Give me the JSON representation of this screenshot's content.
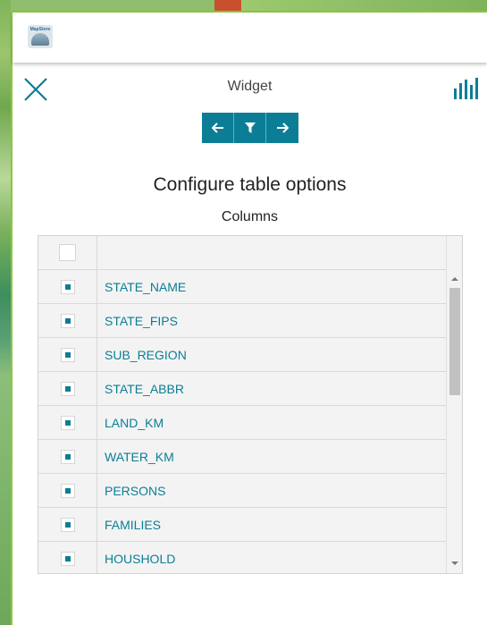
{
  "app": {
    "logo_text": "MapStore"
  },
  "header": {
    "widget_title": "Widget"
  },
  "toolbar": {
    "buttons": [
      {
        "name": "back",
        "icon": "arrow-left-icon"
      },
      {
        "name": "filter",
        "icon": "filter-icon"
      },
      {
        "name": "next",
        "icon": "arrow-right-icon"
      }
    ]
  },
  "main": {
    "page_title": "Configure table options",
    "section_title": "Columns"
  },
  "table": {
    "header_checked": false,
    "columns": [
      {
        "label": "STATE_NAME",
        "checked": true
      },
      {
        "label": "STATE_FIPS",
        "checked": true
      },
      {
        "label": "SUB_REGION",
        "checked": true
      },
      {
        "label": "STATE_ABBR",
        "checked": true
      },
      {
        "label": "LAND_KM",
        "checked": true
      },
      {
        "label": "WATER_KM",
        "checked": true
      },
      {
        "label": "PERSONS",
        "checked": true
      },
      {
        "label": "FAMILIES",
        "checked": true
      },
      {
        "label": "HOUSHOLD",
        "checked": true
      }
    ]
  },
  "colors": {
    "accent": "#0b7e96",
    "panel_border": "#8dc63f"
  }
}
